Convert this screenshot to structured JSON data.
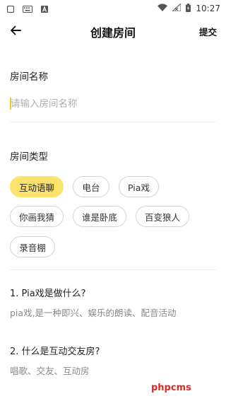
{
  "status_bar": {
    "time": "10:27",
    "left_icons": [
      "square-notification-icon",
      "keyboard-icon",
      "font-a-icon"
    ],
    "right_icons": [
      "wifi-icon",
      "signal-off-icon",
      "battery-charging-icon"
    ]
  },
  "header": {
    "title": "创建房间",
    "submit_label": "提交"
  },
  "room_name": {
    "label": "房间名称",
    "placeholder": "请输入房间名称",
    "value": ""
  },
  "room_type": {
    "label": "房间类型",
    "options": [
      {
        "label": "互动语聊",
        "selected": true
      },
      {
        "label": "电台",
        "selected": false
      },
      {
        "label": "Pia戏",
        "selected": false
      },
      {
        "label": "你画我猜",
        "selected": false
      },
      {
        "label": "谁是卧底",
        "selected": false
      },
      {
        "label": "百变狼人",
        "selected": false
      },
      {
        "label": "录音棚",
        "selected": false
      }
    ]
  },
  "faq": [
    {
      "question": "1. Pia戏是做什么?",
      "answer": "pia戏,是一种即兴、娱乐的朗读、配音活动"
    },
    {
      "question": "2. 什么是互动交友房?",
      "answer": "唱歌、交友、互动房"
    }
  ],
  "watermark": "phpcms",
  "colors": {
    "accent": "#fbe26a",
    "cursor": "#f0c330",
    "watermark": "#e3261f"
  }
}
